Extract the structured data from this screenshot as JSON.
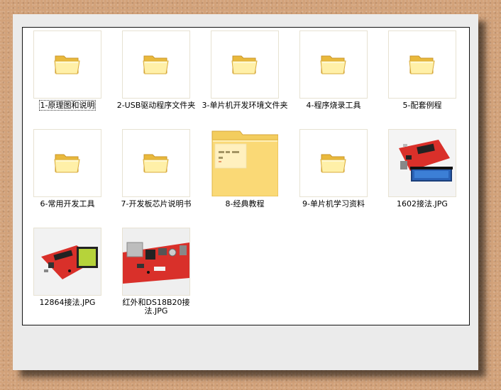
{
  "files": [
    {
      "label": "1-原理图和说明",
      "type": "folder"
    },
    {
      "label": "2-USB驱动程序文件夹",
      "type": "folder"
    },
    {
      "label": "3-单片机开发环境文件夹",
      "type": "folder"
    },
    {
      "label": "4-程序烧录工具",
      "type": "folder"
    },
    {
      "label": "5-配套例程",
      "type": "folder"
    },
    {
      "label": "6-常用开发工具",
      "type": "folder"
    },
    {
      "label": "7-开发板芯片说明书",
      "type": "folder"
    },
    {
      "label": "8-经典教程",
      "type": "folder-with-preview"
    },
    {
      "label": "9-单片机学习资料",
      "type": "folder"
    },
    {
      "label": "1602接法.JPG",
      "type": "image"
    },
    {
      "label": "12864接法.JPG",
      "type": "image"
    },
    {
      "label": "红外和DS18B20接法.JPG",
      "type": "image"
    }
  ],
  "colors": {
    "folder_light": "#fff0a8",
    "folder_dark": "#e9b93c",
    "board_red": "#d9302a",
    "lcd_green": "#b6d33a",
    "lcd_blue": "#2a63b8"
  }
}
